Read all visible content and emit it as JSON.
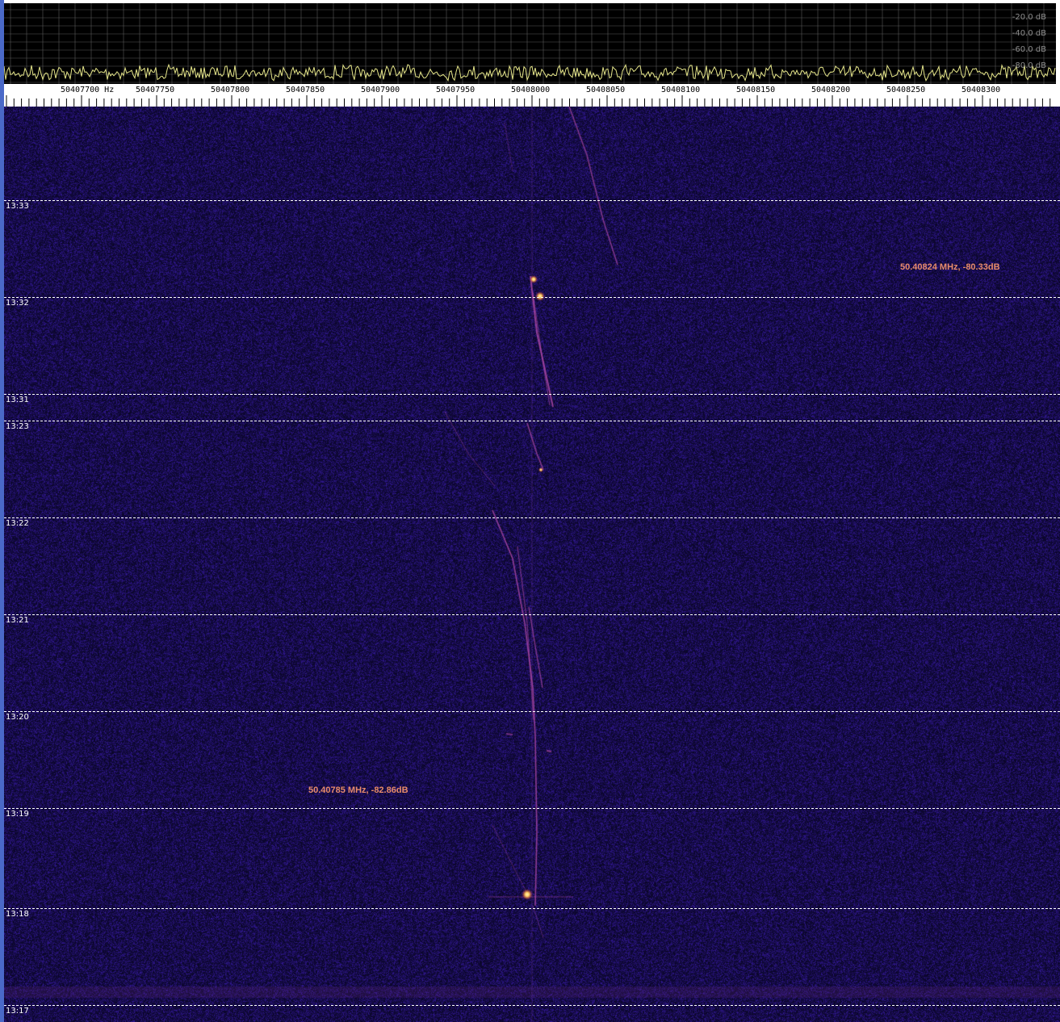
{
  "spectrum": {
    "db_labels": [
      "-20.0 dB",
      "-40.0 dB",
      "-60.0 dB",
      "-80.0 dB"
    ],
    "trace_color": "#e6e68a",
    "grid_color": "#5a5a5a"
  },
  "freq_axis": {
    "labels": [
      "50407700 Hz",
      "50407750",
      "50407800",
      "50407850",
      "50407900",
      "50407950",
      "50408000",
      "50408050",
      "50408100",
      "50408150",
      "50408200",
      "50408250",
      "50408300"
    ]
  },
  "waterfall": {
    "time_labels": [
      "13:33",
      "13:32",
      "13:31",
      "13:23",
      "13:22",
      "13:21",
      "13:20",
      "13:19",
      "13:18",
      "13:17"
    ],
    "background_color": "#15104a",
    "signal_color": "#b04aa8",
    "peak_color": "#ffd060"
  },
  "markers": [
    {
      "label": "50.40824 MHz, -80.33dB"
    },
    {
      "label": "50.40785 MHz, -82.86dB"
    }
  ]
}
